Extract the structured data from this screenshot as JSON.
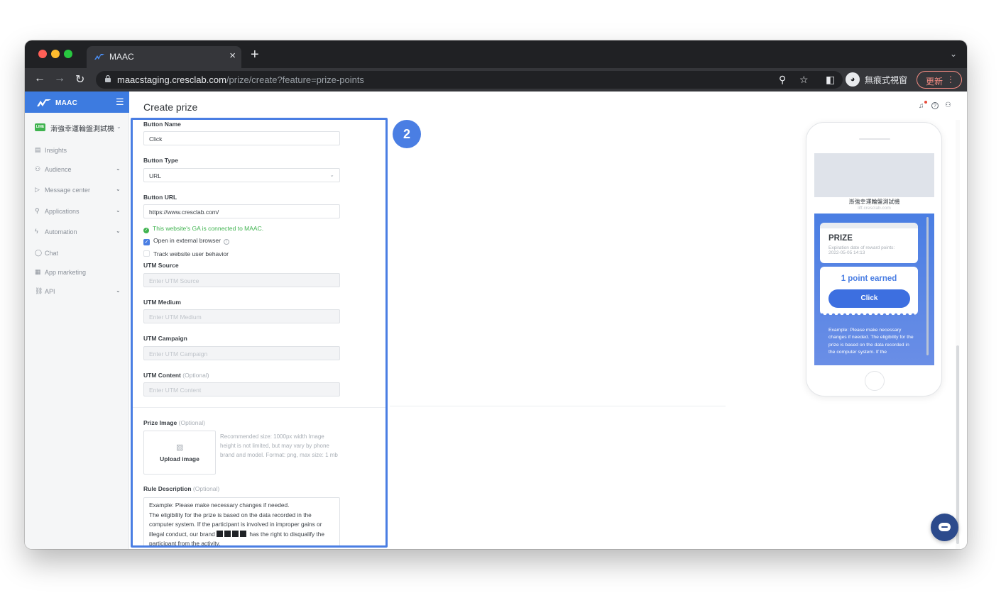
{
  "browser": {
    "tab_title": "MAAC",
    "tab_close": "×",
    "new_tab": "+",
    "tab_menu": "⌄",
    "url_host": "maacstaging.cresclab.com",
    "url_path": "/prize/create?feature=prize-points",
    "incognito_label": "無痕式視窗",
    "update_label": "更新",
    "update_menu": "⋮",
    "colors": {
      "frame": "#202124",
      "toolbar": "#35363a",
      "update": "#f28b82"
    }
  },
  "sidebar": {
    "brand": "MAAC",
    "menu_icon": "☰",
    "channel_badge": "LINE",
    "channel_name": "漸強幸運輪盤測試機",
    "channel_chevron": "⌄",
    "items": [
      {
        "label": "Insights",
        "icon": "chart-icon",
        "glyph": "▤",
        "expandable": false
      },
      {
        "label": "Audience",
        "icon": "person-icon",
        "glyph": "⚇",
        "expandable": true
      },
      {
        "label": "Message center",
        "icon": "send-icon",
        "glyph": "▷",
        "expandable": true
      },
      {
        "label": "Applications",
        "icon": "puzzle-icon",
        "glyph": "⚲",
        "expandable": true
      },
      {
        "label": "Automation",
        "icon": "bolt-icon",
        "glyph": "ϟ",
        "expandable": true
      },
      {
        "label": "Chat",
        "icon": "chat-icon",
        "glyph": "◯",
        "expandable": false
      },
      {
        "label": "App marketing",
        "icon": "app-icon",
        "glyph": "▦",
        "expandable": false
      },
      {
        "label": "API",
        "icon": "link-icon",
        "glyph": "⛓",
        "expandable": true
      }
    ],
    "accent": "#3d7be0"
  },
  "header": {
    "title": "Create prize",
    "icons": {
      "bell": "🔔",
      "help": "?",
      "user": "⚇"
    }
  },
  "form": {
    "button_name_label": "Button Name",
    "button_name_value": "Click",
    "button_type_label": "Button Type",
    "button_type_value": "URL",
    "button_url_label": "Button URL",
    "button_url_value": "https://www.cresclab.com/",
    "ga_status": "This website's GA is connected to MAAC.",
    "open_external_label": "Open in external browser",
    "open_external_checked": true,
    "track_behavior_label": "Track website user behavior",
    "track_behavior_checked": false,
    "utm_source_label": "UTM Source",
    "utm_source_placeholder": "Enter UTM Source",
    "utm_medium_label": "UTM Medium",
    "utm_medium_placeholder": "Enter UTM Medium",
    "utm_campaign_label": "UTM Campaign",
    "utm_campaign_placeholder": "Enter UTM Campaign",
    "utm_content_label": "UTM Content",
    "utm_content_placeholder": "Enter UTM Content",
    "optional": "(Optional)",
    "prize_image_label": "Prize Image",
    "upload_label": "Upload image",
    "upload_hint": "Recommended size: 1000px width Image height is not limited, but may vary by phone brand and model. Format: png, max size: 1 mb",
    "rule_description_label": "Rule Description",
    "rule_text_1": "Example: Please make necessary changes if needed.",
    "rule_text_2": "The eligibility for the prize is based on the data recorded in the computer system. If the participant is involved in improper gains or illegal conduct, our brand",
    "rule_text_3": "has the right to disqualify the participant from the activity.",
    "success_color": "#3fb34f",
    "highlight_color": "#4a7ee3"
  },
  "step_badge": "2",
  "preview": {
    "shop_name": "漸強幸運輪盤測試機",
    "shop_url": "liff.cresclab.com",
    "prize_title": "PRIZE",
    "expiration": "Expiration date of reward points: 2022-05-05 14:13",
    "points_earned": "1 point earned",
    "button_label": "Click",
    "description": "Example: Please make necessary changes if needed. The eligibility for the prize is based on the data recorded in the computer system. If the"
  }
}
